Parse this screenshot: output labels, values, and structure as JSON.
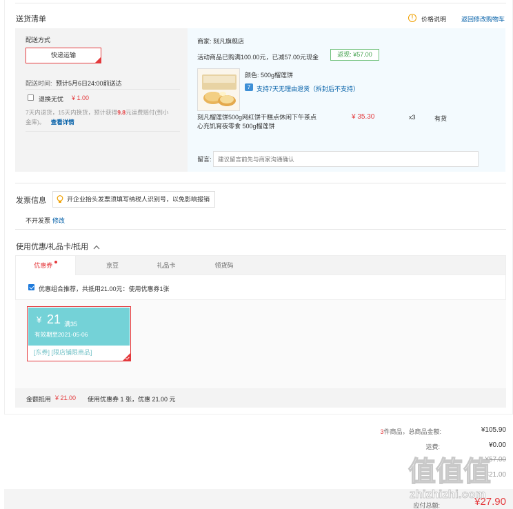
{
  "delivery": {
    "section_title": "送货清单",
    "price_note_label": "价格说明",
    "back_to_cart_label": "返回修改购物车",
    "ship_method_label": "配送方式",
    "ship_method_value": "快递运输",
    "ship_time_label": "配送时间:",
    "ship_time_value": "预计5月6日24:00前送达",
    "return_label": "退换无忧",
    "return_price": "¥ 1.00",
    "return_desc_a": "7天内退货，15天内换货，预计获得",
    "return_desc_highlight": "9.8",
    "return_desc_b": "元运费赔付(到小",
    "return_desc_c": "金库)。",
    "view_details_label": "查看详情"
  },
  "shop": {
    "name": "商家: 刻凡旗舰店",
    "promo_text": "活动商品已购满100.00元，已减57.00元现金",
    "rebate_tag": "返现: ¥57.00",
    "item": {
      "color_label": "颜色: 500g榴莲饼",
      "return_policy": "支持7天无理由退货（拆封后不支持）",
      "return_badge": "7",
      "title_line1": "刻凡榴莲饼500g网红饼干糕点休闲下午茶点",
      "title_line2": "心充饥宵夜零食 500g榴莲饼",
      "price": "¥ 35.30",
      "qty": "x3",
      "stock": "有货"
    },
    "note_label": "留言:",
    "note_placeholder": "建议留言前先与商家沟通确认"
  },
  "invoice": {
    "section_title": "发票信息",
    "tip": "开企业抬头发票须填写纳税人识别号，以免影响报销",
    "status": "不开发票",
    "edit_label": "修改"
  },
  "coupons": {
    "section_title": "使用优惠/礼品卡/抵用",
    "tabs": [
      {
        "label": "优惠券"
      },
      {
        "label": "京豆"
      },
      {
        "label": "礼品卡"
      },
      {
        "label": "领货码"
      }
    ],
    "combo_text": "优惠组合推荐，共抵用21.00元：使用优惠券1张",
    "coupon": {
      "currency": "¥",
      "amount": "21",
      "condition": "满35",
      "valid": "有效期至2021-05-06",
      "tags": "[东券] [限店铺限商品]"
    },
    "summary_label": "金额抵用",
    "summary_amount": "¥ 21.00",
    "summary_desc": "使用优惠券 1 张，优惠 21.00 元"
  },
  "totals": {
    "count": "3",
    "count_label": "件商品，总商品金额:",
    "goods_amount": "¥105.90",
    "shipping_label": "运费:",
    "shipping_amount": "¥0.00",
    "discount_amount": "-¥57.00",
    "coupon_amount": "-¥21.00",
    "payable_label": "应付总额:",
    "payable_amount": "¥27.90"
  },
  "watermark": {
    "text": "值值值",
    "site": "zhizhizhi.com"
  },
  "colors": {
    "accent_red": "#e4393c",
    "link_blue": "#005ea7",
    "coupon_teal": "#74d2d7",
    "panel_blue": "#f3fafe"
  }
}
